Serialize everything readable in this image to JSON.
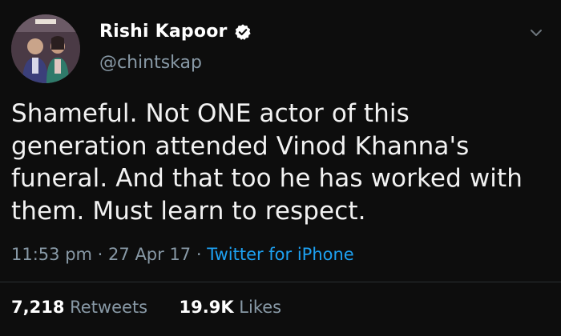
{
  "user": {
    "display_name": "Rishi Kapoor",
    "handle": "@chintskap",
    "verified": true,
    "avatar_icon": "profile-photo"
  },
  "tweet": {
    "text": "Shameful. Not ONE actor of this generation attended Vinod Khanna's funeral. And that too he has worked with them. Must learn to respect.",
    "time": "11:53 pm",
    "date": "27 Apr 17",
    "separator": "·",
    "source": "Twitter for iPhone"
  },
  "stats": {
    "retweets_count": "7,218",
    "retweets_label": "Retweets",
    "likes_count": "19.9K",
    "likes_label": "Likes"
  },
  "colors": {
    "background": "#0d0d0d",
    "secondary_text": "#8899a6",
    "link": "#1da1f2",
    "verified_badge": "#ffffff"
  }
}
